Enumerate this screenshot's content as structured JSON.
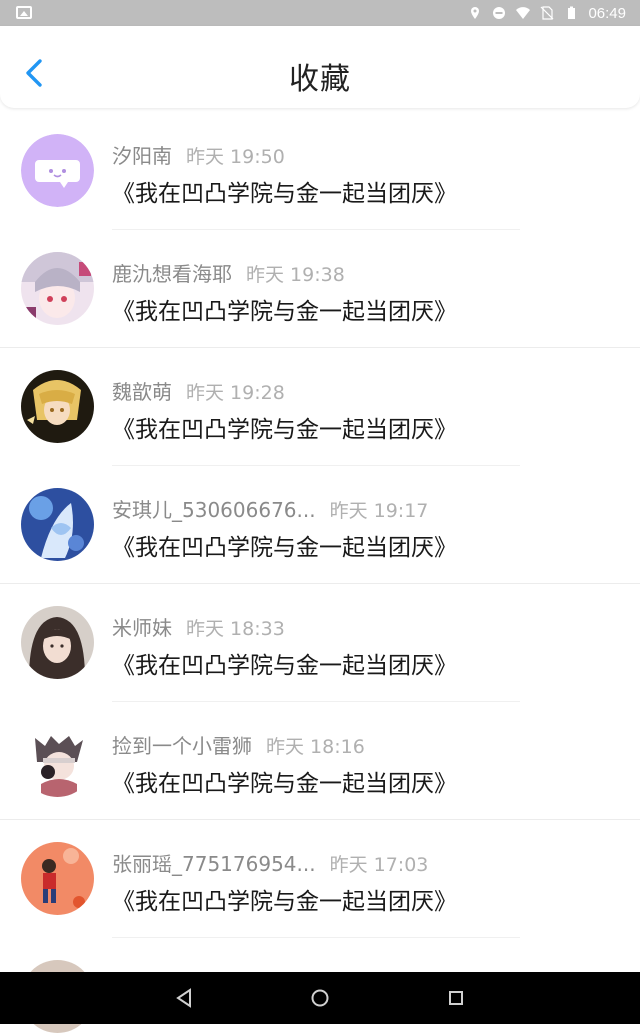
{
  "status_bar": {
    "time": "06:49",
    "icons": [
      "image-icon",
      "location-icon",
      "dnd-icon",
      "wifi-icon",
      "no-sim-icon",
      "battery-icon"
    ]
  },
  "header": {
    "title": "收藏",
    "back_icon": "chevron-left-icon",
    "accent": "#2196f3"
  },
  "items": [
    {
      "name": "汐阳南",
      "time": "昨天 19:50",
      "content": "《我在凹凸学院与金一起当团厌》",
      "avatar_color": "#c9a6f5",
      "divider": "short"
    },
    {
      "name": "鹿氿想看海耶",
      "time": "昨天 19:38",
      "content": "《我在凹凸学院与金一起当团厌》",
      "avatar_color": "#e7c8d9",
      "divider": "full"
    },
    {
      "name": "魏歆萌",
      "time": "昨天 19:28",
      "content": "《我在凹凸学院与金一起当团厌》",
      "avatar_color": "#2a2316",
      "divider": "short"
    },
    {
      "name": "安琪儿_530606676...",
      "time": "昨天 19:17",
      "content": "《我在凹凸学院与金一起当团厌》",
      "avatar_color": "#4b6fb8",
      "divider": "full"
    },
    {
      "name": "米师妹",
      "time": "昨天 18:33",
      "content": "《我在凹凸学院与金一起当团厌》",
      "avatar_color": "#5a4a44",
      "divider": "short"
    },
    {
      "name": "捡到一个小雷狮",
      "time": "昨天 18:16",
      "content": "《我在凹凸学院与金一起当团厌》",
      "avatar_color": "#dcd3d4",
      "divider": "full"
    },
    {
      "name": "张丽瑶_775176954...",
      "time": "昨天 17:03",
      "content": "《我在凹凸学院与金一起当团厌》",
      "avatar_color": "#f08a6a",
      "divider": "short"
    }
  ],
  "nav": {
    "back": "triangle-back-icon",
    "home": "circle-home-icon",
    "recents": "square-recents-icon"
  }
}
